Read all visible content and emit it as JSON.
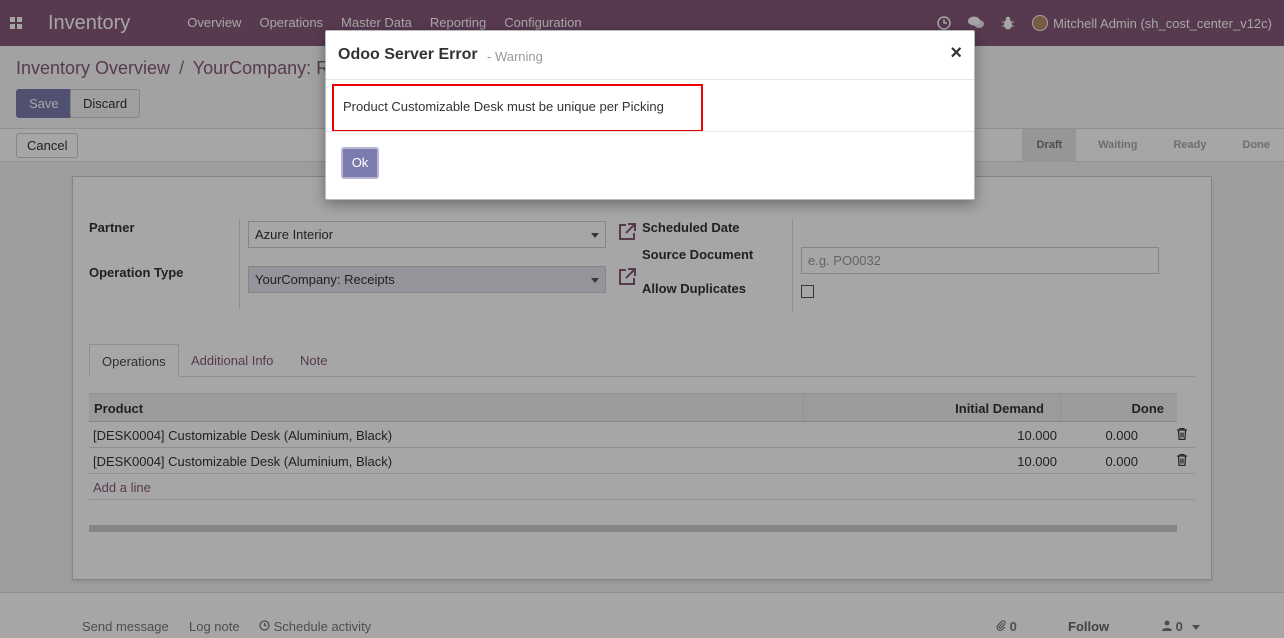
{
  "navbar": {
    "brand": "Inventory",
    "menu": [
      "Overview",
      "Operations",
      "Master Data",
      "Reporting",
      "Configuration"
    ],
    "user": "Mitchell Admin (sh_cost_center_v12c)"
  },
  "breadcrumb": {
    "parent": "Inventory Overview",
    "separator": "/",
    "current": "YourCompany: Receipts"
  },
  "toolbar": {
    "save": "Save",
    "discard": "Discard"
  },
  "statusbar": {
    "cancel": "Cancel",
    "stages": [
      "Draft",
      "Waiting",
      "Ready",
      "Done"
    ],
    "active_stage": "Draft"
  },
  "form": {
    "partner_label": "Partner",
    "partner_value": "Azure Interior",
    "operation_type_label": "Operation Type",
    "operation_type_value": "YourCompany: Receipts",
    "scheduled_date_label": "Scheduled Date",
    "source_document_label": "Source Document",
    "source_document_placeholder": "e.g. PO0032",
    "allow_duplicates_label": "Allow Duplicates",
    "allow_duplicates_checked": false
  },
  "tabs": [
    "Operations",
    "Additional Info",
    "Note"
  ],
  "table": {
    "headers": {
      "product": "Product",
      "initial_demand": "Initial Demand",
      "done": "Done"
    },
    "rows": [
      {
        "product": "[DESK0004] Customizable Desk (Aluminium, Black)",
        "initial_demand": "10.000",
        "done": "0.000"
      },
      {
        "product": "[DESK0004] Customizable Desk (Aluminium, Black)",
        "initial_demand": "10.000",
        "done": "0.000"
      }
    ],
    "add_line": "Add a line"
  },
  "chatter": {
    "send_message": "Send message",
    "log_note": "Log note",
    "schedule_activity": "Schedule activity",
    "attachments_count": "0",
    "follow": "Follow",
    "followers_count": "0"
  },
  "modal": {
    "title": "Odoo Server Error",
    "subtitle": "- Warning",
    "close": "×",
    "message": "Product Customizable Desk must be unique per Picking",
    "ok": "Ok"
  },
  "colors": {
    "navbar": "#875a7b",
    "primary_button": "#7c7bad",
    "highlight_border": "#e00000"
  }
}
